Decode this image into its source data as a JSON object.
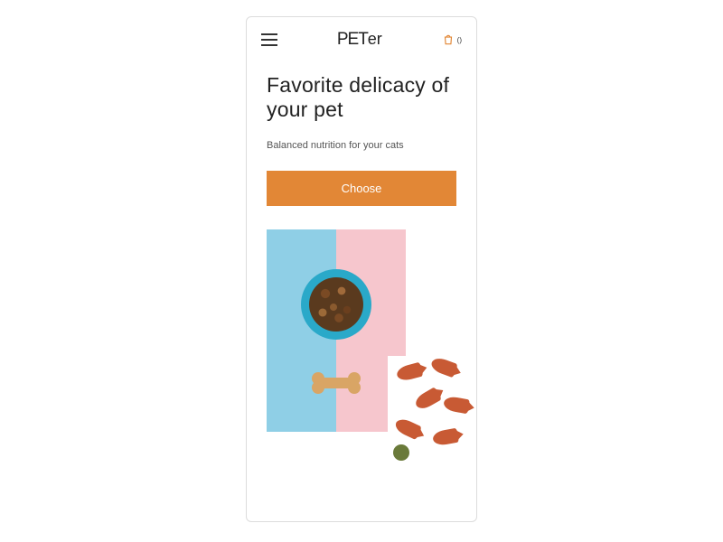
{
  "header": {
    "logo_text": "PETer",
    "cart_count": "()"
  },
  "hero": {
    "headline": "Favorite delicacy of your pet",
    "subline": "Balanced nutrition for your cats",
    "cta_label": "Choose"
  },
  "colors": {
    "accent": "#e28736",
    "panel_blue": "#8fcfe6",
    "panel_pink": "#f6c6cd"
  }
}
